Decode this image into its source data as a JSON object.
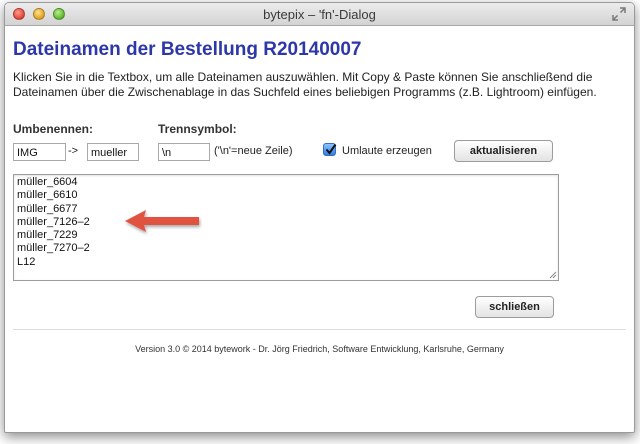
{
  "window": {
    "title": "bytepix – 'fn'-Dialog"
  },
  "heading": "Dateinamen der Bestellung R20140007",
  "description": "Klicken Sie in die Textbox, um alle Dateinamen auszuwählen. Mit Copy & Paste können Sie anschließend die Dateinamen über die Zwischenablage in das Suchfeld eines beliebigen Programms (z.B. Lightroom) einfügen.",
  "rename": {
    "label": "Umbenennen:",
    "from_value": "IMG",
    "arrow": "->",
    "to_value": "mueller"
  },
  "separator": {
    "label": "Trennsymbol:",
    "value": "\\n",
    "hint": "('\\n'=neue Zeile)"
  },
  "umlaute": {
    "label": "Umlaute erzeugen",
    "checked": true
  },
  "update_button": "aktualisieren",
  "filenames": [
    "müller_6604",
    "müller_6610",
    "müller_6677",
    "müller_7126–2",
    "müller_7229",
    "müller_7270–2",
    "L12"
  ],
  "close_button": "schließen",
  "footer": "Version 3.0 © 2014 bytework - Dr. Jörg Friedrich, Software Entwicklung, Karlsruhe, Germany",
  "colors": {
    "heading": "#2d37a8",
    "annotation_arrow": "#e0533f",
    "checkbox": "#2f7ce6"
  }
}
